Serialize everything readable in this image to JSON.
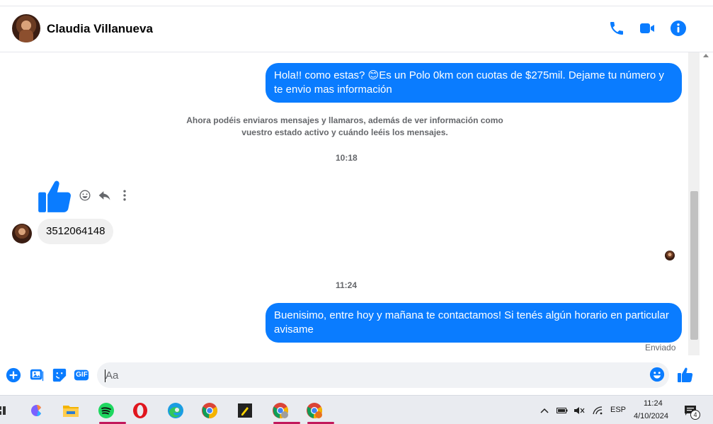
{
  "header": {
    "contact_name": "Claudia Villanueva",
    "icons": [
      "phone-icon",
      "video-camera-icon",
      "info-icon"
    ]
  },
  "messages": {
    "out_1": "Hola!! como estas? 😊Es un Polo 0km con cuotas de $275mil. Dejame tu número y te envio mas información",
    "system_note": "Ahora podéis enviaros mensajes y llamaros, además de ver información como vuestro estado activo y cuándo leéis los mensajes.",
    "time_1": "10:18",
    "in_1": "3512064148",
    "time_2": "11:24",
    "out_2": "Buenisimo, entre hoy y mañana te contactamos! Si tenés algún horario en particular avisame",
    "status": "Enviado"
  },
  "composer": {
    "placeholder": "Aa",
    "gif_label": "GIF"
  },
  "taskbar": {
    "clock_time": "11:24",
    "clock_date": "4/10/2024",
    "language": "ESP",
    "notifications_count": "4"
  },
  "colors": {
    "accent": "#0a7cff",
    "bubble_in": "#f0f0f0",
    "muted_text": "#65676b"
  }
}
